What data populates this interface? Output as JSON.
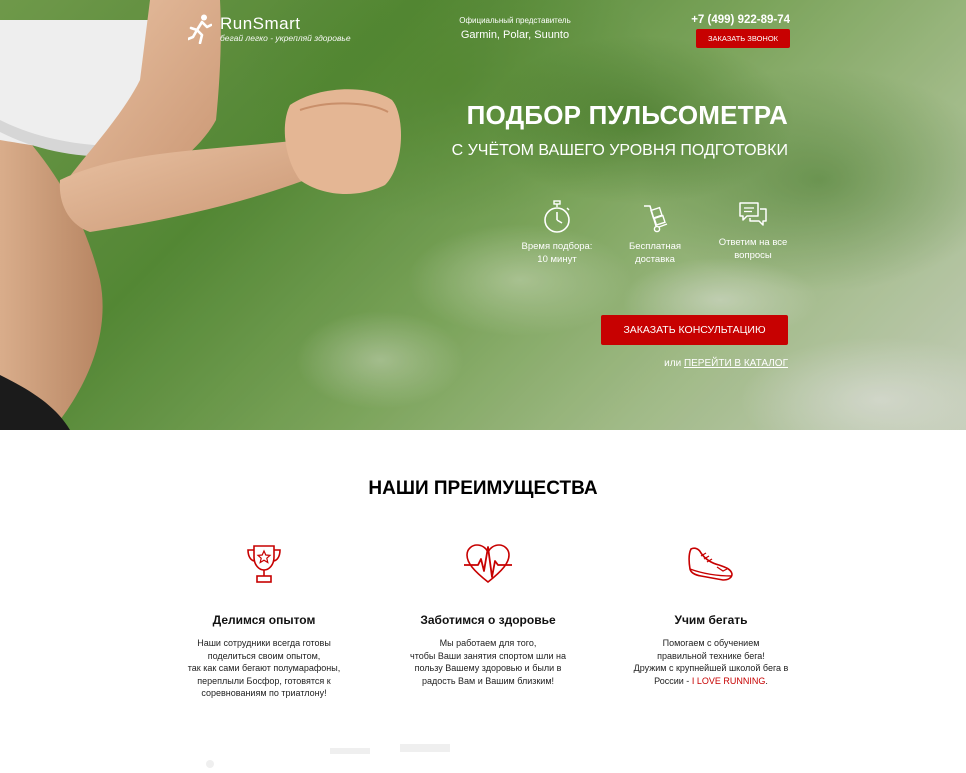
{
  "header": {
    "logo_title": "RunSmart",
    "logo_subtitle": "бегай легко - укрепляй здоровье",
    "dealer_label": "Официальный представитель",
    "dealer_brands": "Garmin, Polar, Suunto",
    "phone": "+7 (499) 922-89-74",
    "callback_label": "ЗАКАЗАТЬ ЗВОНОК"
  },
  "hero": {
    "title": "ПОДБОР ПУЛЬСОМЕТРА",
    "subtitle": "С УЧЁТОМ ВАШЕГО УРОВНЯ ПОДГОТОВКИ",
    "features": [
      {
        "icon": "stopwatch-icon",
        "line1": "Время подбора:",
        "line2": "10 минут"
      },
      {
        "icon": "delivery-icon",
        "line1": "Бесплатная",
        "line2": "доставка"
      },
      {
        "icon": "chat-icon",
        "line1": "Ответим на все",
        "line2": "вопросы"
      }
    ],
    "consult_label": "ЗАКАЗАТЬ КОНСУЛЬТАЦИЮ",
    "or_label": "или ",
    "catalog_label": "ПЕРЕЙТИ В КАТАЛОГ"
  },
  "advantages": {
    "title": "НАШИ ПРЕИМУЩЕСТВА",
    "items": [
      {
        "icon": "trophy-icon",
        "title": "Делимся опытом",
        "text": "Наши сотрудники всегда готовы\nподелиться своим опытом,\nтак как сами бегают полумарафоны,\nпереплыли Босфор, готовятся к\nсоревнованиям по триатлону!"
      },
      {
        "icon": "heart-pulse-icon",
        "title": "Заботимся о здоровье",
        "text": "Мы работаем для того,\nчтобы Ваши занятия спортом шли на\nпользу Вашему здоровью и были в\nрадость Вам и Вашим близким!"
      },
      {
        "icon": "sneaker-icon",
        "title": "Учим бегать",
        "text": "Помогаем с обучением\nправильной технике бега!\nДружим с крупнейшей школой бега в\nРоссии - ",
        "accent": "I LOVE RUNNING",
        "text_end": "."
      }
    ]
  },
  "colors": {
    "accent_red": "#c70101",
    "white": "#ffffff"
  }
}
